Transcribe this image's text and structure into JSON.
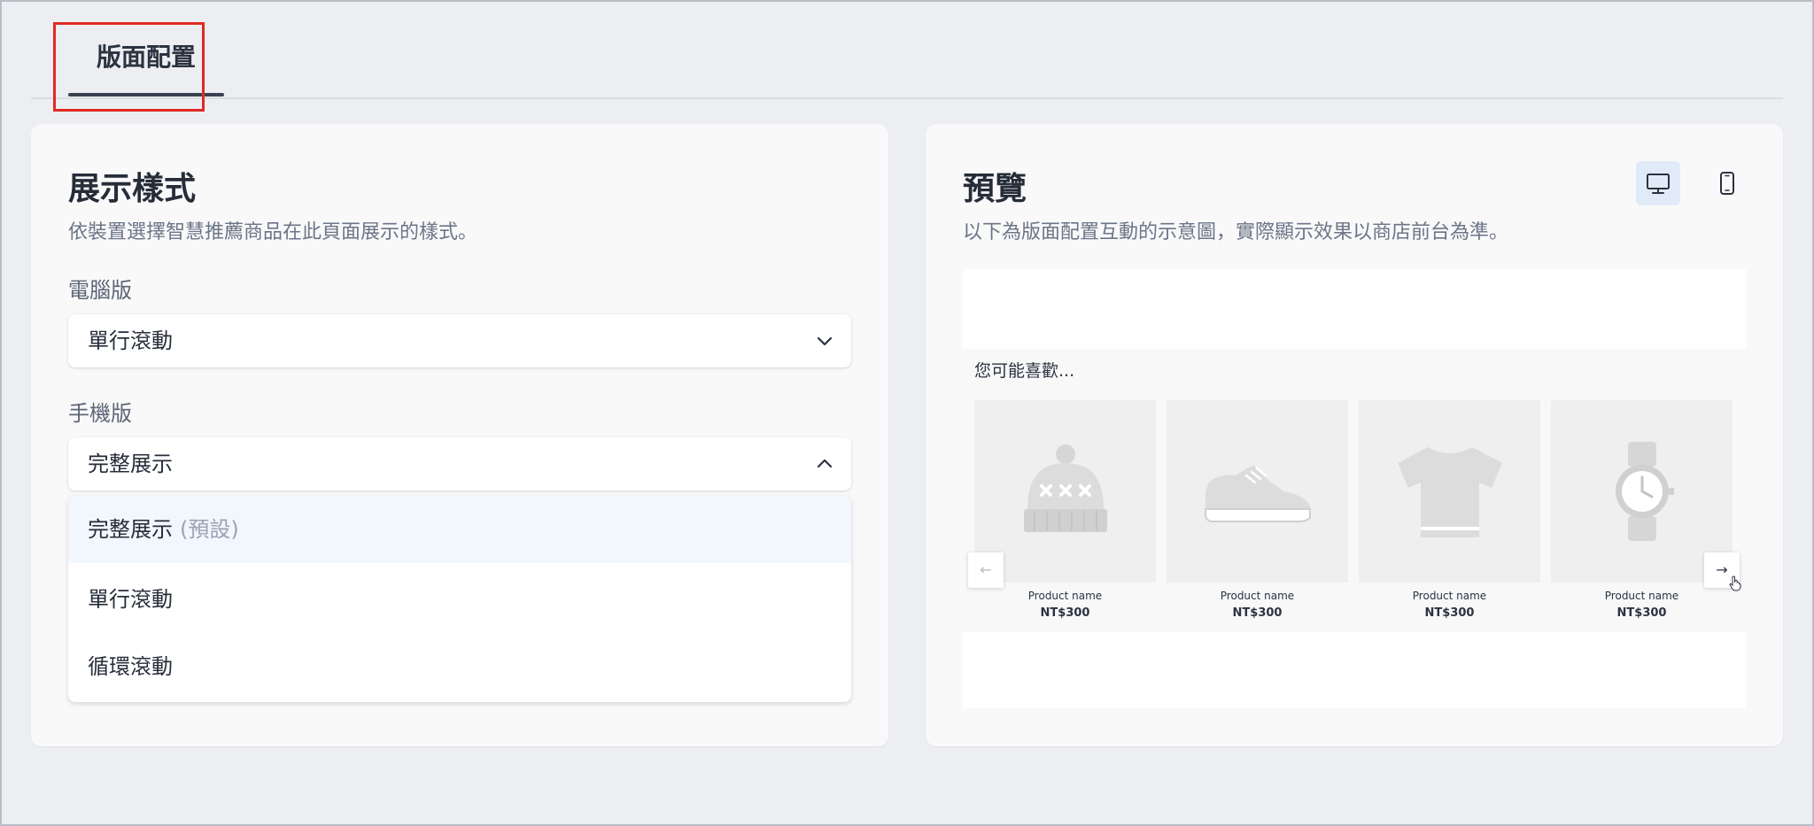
{
  "tabs": [
    {
      "label": "版面配置",
      "active": true
    }
  ],
  "display_style": {
    "title": "展示樣式",
    "description": "依裝置選擇智慧推薦商品在此頁面展示的樣式。",
    "desktop": {
      "label": "電腦版",
      "value": "單行滾動"
    },
    "mobile": {
      "label": "手機版",
      "value": "完整展示",
      "expanded": true,
      "options": [
        {
          "label": "完整展示",
          "hint": "(預設)",
          "selected": true
        },
        {
          "label": "單行滾動",
          "hint": "",
          "selected": false
        },
        {
          "label": "循環滾動",
          "hint": "",
          "selected": false
        }
      ]
    }
  },
  "preview": {
    "title": "預覽",
    "description": "以下為版面配置互動的示意圖，實際顯示效果以商店前台為準。",
    "active_device": "desktop",
    "section_title": "您可能喜歡...",
    "prev_arrow": "←",
    "next_arrow": "→",
    "products": [
      {
        "name": "Product name",
        "price": "NT$300",
        "icon": "beanie-icon"
      },
      {
        "name": "Product name",
        "price": "NT$300",
        "icon": "sneaker-icon"
      },
      {
        "name": "Product name",
        "price": "NT$300",
        "icon": "tshirt-icon"
      },
      {
        "name": "Product name",
        "price": "NT$300",
        "icon": "watch-icon"
      }
    ]
  },
  "colors": {
    "background": "#eceef1",
    "card": "#f9f9fa",
    "highlight": "#e02a24",
    "selected_option": "#f2f6fd",
    "active_device": "#e1eaf7"
  }
}
